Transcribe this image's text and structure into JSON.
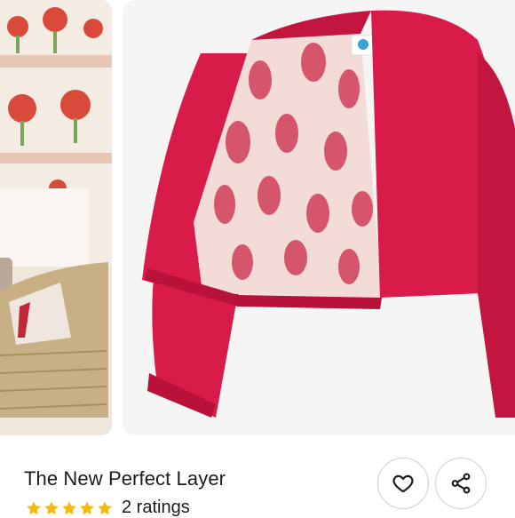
{
  "product": {
    "title": "The New Perfect Layer",
    "rating": {
      "stars": 5,
      "count_label": "2 ratings"
    }
  },
  "gallery": {
    "images": [
      {
        "subject": "wicker chair in front of floral block-print wallpaper"
      },
      {
        "subject": "pink cropped jacket with floral block-print lining"
      }
    ]
  },
  "actions": {
    "favorite_icon": "heart-icon",
    "share_icon": "share-icon"
  },
  "colors": {
    "star": "#f6b90e",
    "jacket": "#d81b48",
    "text": "#1b1b1b"
  }
}
